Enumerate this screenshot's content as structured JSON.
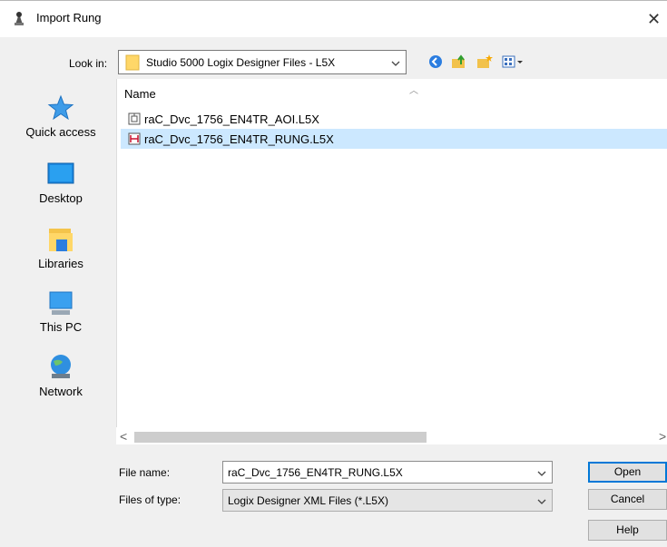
{
  "titlebar": {
    "title": "Import Rung",
    "close_glyph": "✕"
  },
  "toolbar": {
    "look_in_label": "Look in:",
    "look_in_value": "Studio 5000 Logix Designer Files - L5X",
    "buttons": [
      "back-icon",
      "up-folder-icon",
      "new-folder-icon",
      "view-menu-icon"
    ]
  },
  "places": [
    {
      "label": "Quick access",
      "icon": "star-icon"
    },
    {
      "label": "Desktop",
      "icon": "desktop-icon"
    },
    {
      "label": "Libraries",
      "icon": "libraries-icon"
    },
    {
      "label": "This PC",
      "icon": "computer-icon"
    },
    {
      "label": "Network",
      "icon": "network-icon"
    }
  ],
  "file_list": {
    "column_name": "Name",
    "files": [
      {
        "name": "raC_Dvc_1756_EN4TR_AOI.L5X",
        "icon": "aoi-file-icon",
        "selected": false
      },
      {
        "name": "raC_Dvc_1756_EN4TR_RUNG.L5X",
        "icon": "rung-file-icon",
        "selected": true
      }
    ]
  },
  "form": {
    "file_name_label": "File name:",
    "file_name_value": "raC_Dvc_1756_EN4TR_RUNG.L5X",
    "file_type_label": "Files of type:",
    "file_type_value": "Logix Designer XML Files (*.L5X)"
  },
  "buttons": {
    "open": "Open",
    "cancel": "Cancel",
    "help": "Help"
  },
  "colors": {
    "selection": "#cce8ff",
    "accent": "#0078d7",
    "folder": "#ffd768"
  }
}
